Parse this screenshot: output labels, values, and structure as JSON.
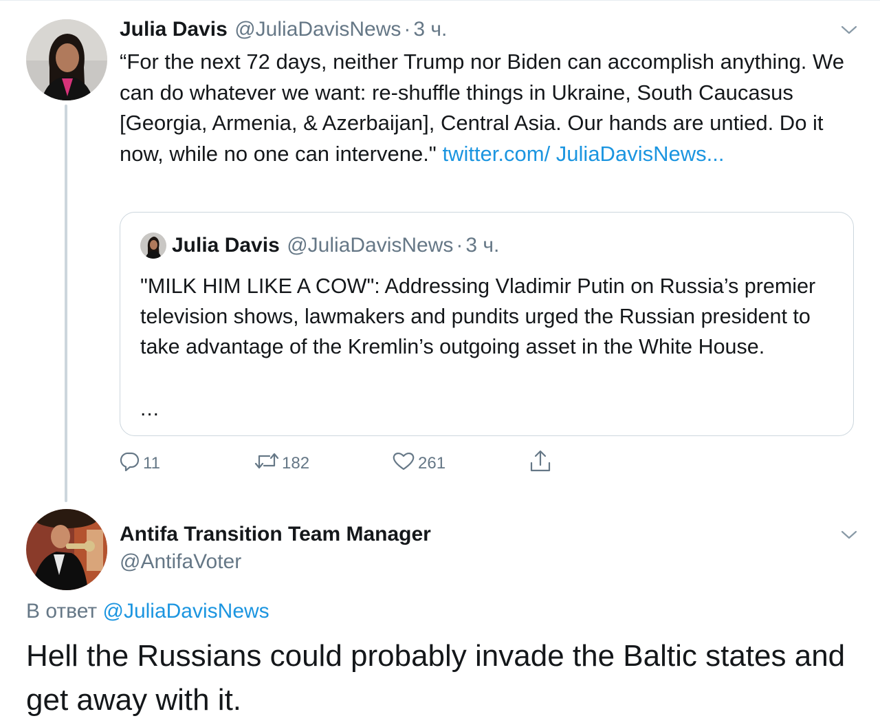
{
  "tweet": {
    "author_name": "Julia Davis",
    "author_handle": "@JuliaDavisNews",
    "separator": "·",
    "time": "3 ч.",
    "text": "“For the next 72 days, neither Trump nor Biden can accomplish anything. We can do whatever we want: re-shuffle things in Ukraine, South Caucasus [Georgia, Armenia, & Azerbaijan], Central Asia. Our hands are untied. Do it now, while no one can intervene.\"",
    "link_text": "twitter.com/ JuliaDavisNews...",
    "quote": {
      "author_name": "Julia Davis",
      "author_handle": "@JuliaDavisNews",
      "separator": "·",
      "time": "3 ч.",
      "text": "\"MILK HIM LIKE A COW\": Addressing Vladimir Putin on Russia’s premier television shows, lawmakers and pundits urged the Russian president to take advantage of the Kremlin’s outgoing asset in the White House.",
      "ellipsis": "..."
    },
    "actions": {
      "reply_count": "11",
      "retweet_count": "182",
      "like_count": "261"
    },
    "icons": [
      "chevron-down-icon",
      "reply-icon",
      "retweet-icon",
      "like-icon",
      "share-icon"
    ]
  },
  "reply": {
    "author_name": "Antifa Transition Team Manager",
    "author_handle": "@AntifaVoter",
    "reply_to_prefix": "В ответ",
    "reply_to_handle": "@JuliaDavisNews",
    "text": "Hell the Russians could probably invade the Baltic states and get away with it."
  },
  "colors": {
    "link": "#1b95e0",
    "secondary_text": "#657786",
    "border": "#ccd6dd"
  }
}
